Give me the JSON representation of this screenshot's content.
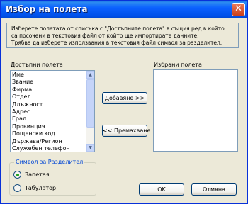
{
  "window": {
    "title": "Избор на полета",
    "close_glyph": "✕"
  },
  "info": {
    "lines": [
      "Изберете полетата от списъка с \"Достъпните полета\" в същия ред в който",
      "са посочени в текстовия файл от който ще импортирате данните.",
      "Трябва да изберете използвания в текстовия файл символ за разделител."
    ]
  },
  "available": {
    "label": "Достъпни полета",
    "items": [
      "Име",
      "Звание",
      "Фирма",
      "Отдел",
      "Длъжност",
      "Адрес",
      "Град",
      "Провинция",
      "Пощенски код",
      "Държава/Регион",
      "Служебен телефон"
    ]
  },
  "selected": {
    "label": "Избрани полета",
    "items": []
  },
  "buttons": {
    "add": "Добавяне >>",
    "remove": "<< Премахване",
    "ok": "OK",
    "cancel": "Отмяна"
  },
  "separator": {
    "title": "Символ за Разделител",
    "options": [
      {
        "label": "Запетая",
        "selected": true
      },
      {
        "label": "Табулатор",
        "selected": false
      }
    ]
  },
  "icons": {
    "scroll_up": "up-arrow-icon",
    "scroll_down": "down-arrow-icon",
    "close": "close-icon"
  },
  "colors": {
    "titlebar": "#0b61ff",
    "dialog_bg": "#ece9d8",
    "group_title": "#0046d5",
    "radio_dot": "#21a121"
  }
}
